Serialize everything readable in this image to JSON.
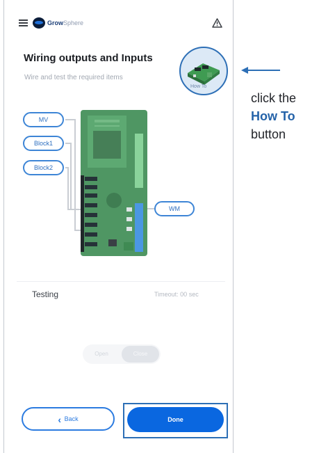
{
  "header": {
    "menu_icon": "hamburger-menu-icon",
    "logo": {
      "brand": "Grow",
      "brand_suffix": "Sphere"
    },
    "alert_icon": "warning-triangle-icon"
  },
  "page": {
    "title": "Wiring outputs and Inputs",
    "subtitle": "Wire and test the required items",
    "howto_label": "How To"
  },
  "wiring": {
    "labels": {
      "mv": "MV",
      "block1": "Block1",
      "block2": "Block2",
      "wm": "WM"
    }
  },
  "testing": {
    "label": "Testing",
    "timeout": "Timeout: 00 sec",
    "toggle": {
      "open": "Open",
      "close": "Close",
      "selected": "Close"
    }
  },
  "footer": {
    "back_label": "Back",
    "done_label": "Done"
  },
  "annotation": {
    "line1": "click the",
    "line2": "How To",
    "line3": "button"
  },
  "colors": {
    "accent": "#0a67e0",
    "annotation": "#2d6fb6",
    "board": "#4f9663"
  }
}
